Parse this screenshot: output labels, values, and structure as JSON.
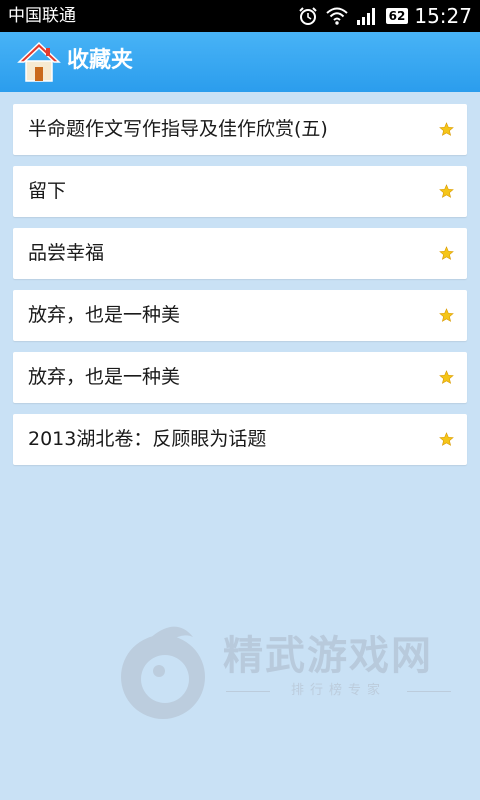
{
  "status_bar": {
    "carrier": "中国联通",
    "battery": "62",
    "time": "15:27"
  },
  "header": {
    "title": "收藏夹",
    "icon": "home-icon"
  },
  "favorites": [
    {
      "title": "半命题作文写作指导及佳作欣赏(五)",
      "icon": "star-icon"
    },
    {
      "title": "留下",
      "icon": "star-icon"
    },
    {
      "title": "品尝幸福",
      "icon": "star-icon"
    },
    {
      "title": "放弃，也是一种美",
      "icon": "star-icon"
    },
    {
      "title": "放弃，也是一种美",
      "icon": "star-icon"
    },
    {
      "title": "2013湖北卷：反顾眼为话题",
      "icon": "star-icon"
    }
  ],
  "watermark": {
    "brand": "精武游戏网",
    "tagline": "排行榜专家"
  },
  "colors": {
    "app_bar": "#2b9ded",
    "background": "#c9e1f5",
    "star": "#f5c518"
  }
}
